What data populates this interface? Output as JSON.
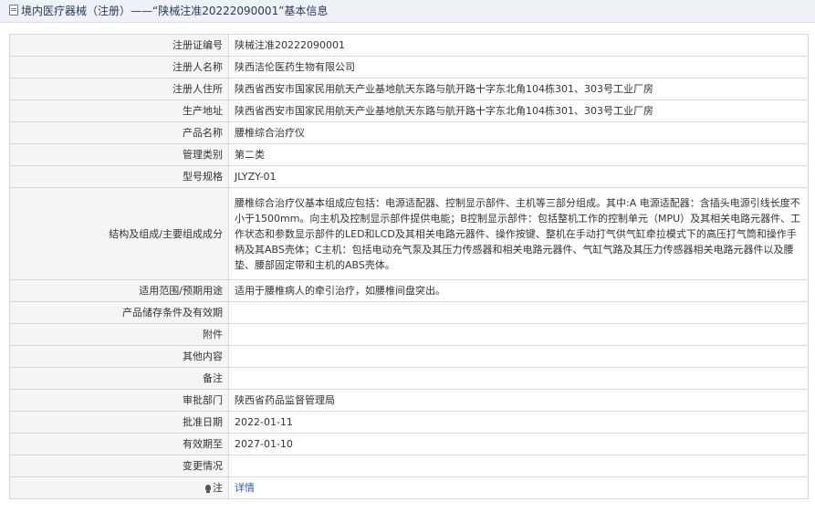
{
  "header": {
    "title": "境内医疗器械（注册）——“陕械注准20222090001”基本信息"
  },
  "rows": [
    {
      "label": "注册证编号",
      "value": "陕械注准20222090001"
    },
    {
      "label": "注册人名称",
      "value": "陕西洁伦医药生物有限公司"
    },
    {
      "label": "注册人住所",
      "value": "陕西省西安市国家民用航天产业基地航天东路与航开路十字东北角104栋301、303号工业厂房"
    },
    {
      "label": "生产地址",
      "value": "陕西省西安市国家民用航天产业基地航天东路与航开路十字东北角104栋301、303号工业厂房"
    },
    {
      "label": "产品名称",
      "value": "腰椎综合治疗仪"
    },
    {
      "label": "管理类别",
      "value": "第二类"
    },
    {
      "label": "型号规格",
      "value": "JLYZY-01"
    },
    {
      "label": "结构及组成/主要组成成分",
      "value": "腰椎综合治疗仪基本组成应包括：电源适配器、控制显示部件、主机等三部分组成。其中:A 电源适配器：含插头电源引线长度不小于1500mm。向主机及控制显示部件提供电能；B控制显示部件：包括整机工作的控制单元（MPU）及其相关电路元器件、工作状态和参数显示部件的LED和LCD及其相关电路元器件、操作按键、整机在手动打气供气缸牵拉模式下的高压打气筒和操作手柄及其ABS壳体；C主机：包括电动充气泵及其压力传感器和相关电路元器件、气缸气路及其压力传感器相关电路元器件以及腰垫、腰部固定带和主机的ABS壳体。"
    },
    {
      "label": "适用范围/预期用途",
      "value": "适用于腰椎病人的牵引治疗，如腰椎间盘突出。"
    },
    {
      "label": "产品储存条件及有效期",
      "value": ""
    },
    {
      "label": "附件",
      "value": ""
    },
    {
      "label": "其他内容",
      "value": ""
    },
    {
      "label": "备注",
      "value": ""
    },
    {
      "label": "审批部门",
      "value": "陕西省药品监督管理局"
    },
    {
      "label": "批准日期",
      "value": "2022-01-11"
    },
    {
      "label": "有效期至",
      "value": "2027-01-10"
    },
    {
      "label": "变更情况",
      "value": ""
    }
  ],
  "note_row": {
    "label": "注",
    "link_text": "详情",
    "icon": "bulb-icon"
  }
}
